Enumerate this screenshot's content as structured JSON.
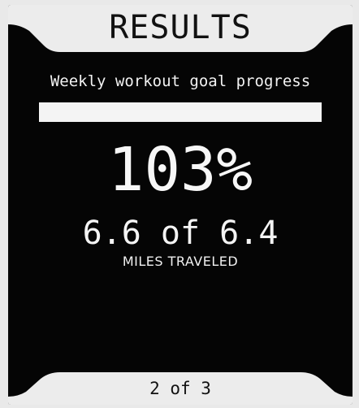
{
  "header": {
    "title": "RESULTS"
  },
  "goal": {
    "subtitle": "Weekly workout goal progress",
    "progress_fraction": 1.0,
    "percent_text": "103%",
    "miles_text": "6.6 of 6.4",
    "miles_label": "MILES TRAVELED"
  },
  "footer": {
    "page_indicator": "2 of 3"
  },
  "colors": {
    "screen_background": "#050505",
    "foreground": "#f4f4f4",
    "tab_background": "#ececec",
    "tab_text": "#111111"
  }
}
